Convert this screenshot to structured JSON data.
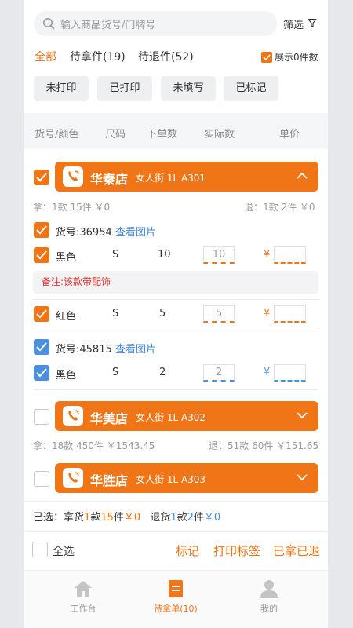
{
  "search": {
    "placeholder": "输入商品货号/门牌号",
    "filter_label": "筛选"
  },
  "tabs": [
    {
      "label": "全部"
    },
    {
      "label": "待拿件(19)"
    },
    {
      "label": "待退件(52)"
    }
  ],
  "show_zero_label": "展示0件数",
  "chips": [
    "未打印",
    "已打印",
    "未填写",
    "已标记"
  ],
  "columns": [
    "货号/颜色",
    "尺码",
    "下单数",
    "实际数",
    "单价"
  ],
  "stores": [
    {
      "name": "华秦店",
      "addr": "女人街 1L A301",
      "take_stat": "拿：1款 15件 ￥0",
      "return_stat": "退：1款 2件 ￥0",
      "items": [
        {
          "sku": "货号:36954",
          "view_link": "查看图片",
          "rows": [
            {
              "color": "黑色",
              "size": "S",
              "ordered": "10",
              "actual": "10",
              "yen": "¥"
            }
          ],
          "note": "备注:该款带配饰"
        },
        {
          "rows": [
            {
              "color": "红色",
              "size": "S",
              "ordered": "5",
              "actual": "5",
              "yen": "¥"
            }
          ]
        },
        {
          "sku": "货号:45815",
          "view_link": "查看图片",
          "rows": [
            {
              "color": "黑色",
              "size": "S",
              "ordered": "2",
              "actual": "2",
              "yen": "¥"
            }
          ]
        }
      ]
    },
    {
      "name": "华美店",
      "addr": "女人街 1L A302",
      "take_stat": "拿：18款 450件 ￥1543.45",
      "return_stat": "退：51款 60件 ￥151.65"
    },
    {
      "name": "华胜店",
      "addr": "女人街 1L A303"
    }
  ],
  "summary": {
    "prefix": "已选：",
    "take_label": "拿货",
    "take_kuan": "1",
    "kuan": "款",
    "take_jian": "15",
    "jian": "件",
    "take_amt": "￥0",
    "return_label": "退货",
    "ret_kuan": "1",
    "ret_jian": "2",
    "ret_amt": "￥0"
  },
  "actions": {
    "select_all": "全选",
    "mark": "标记",
    "print_label": "打印标签",
    "taken_returned": "已拿已退"
  },
  "tabbar": [
    {
      "label": "工作台",
      "icon": "home-icon"
    },
    {
      "label": "待拿单(10)",
      "icon": "order-icon"
    },
    {
      "label": "我的",
      "icon": "user-icon"
    }
  ],
  "colors": {
    "accent": "#f07516",
    "blue": "#4a8fe0",
    "note_red": "#e0332d"
  }
}
